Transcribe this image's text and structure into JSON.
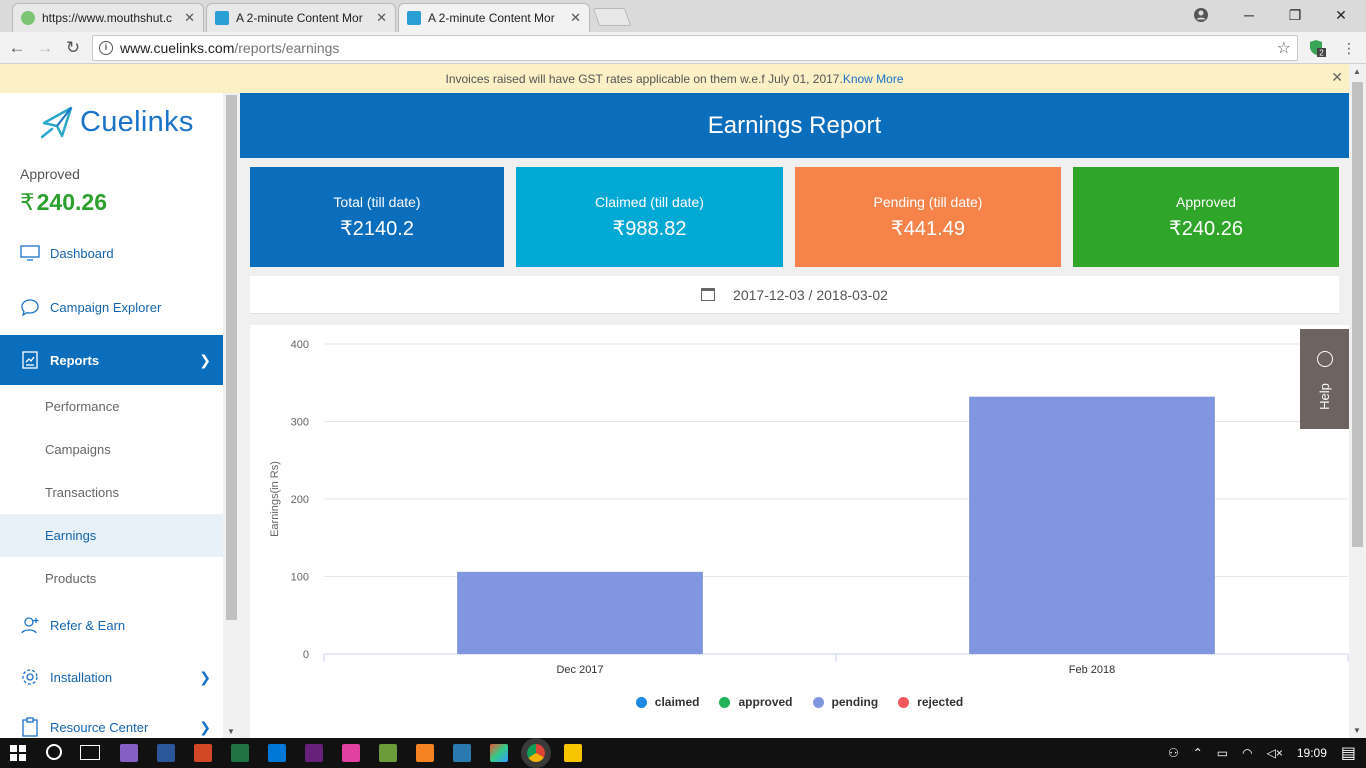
{
  "browser": {
    "tabs": [
      {
        "title": "https://www.mouthshut.c",
        "active": false
      },
      {
        "title": "A 2-minute Content Mor",
        "active": false
      },
      {
        "title": "A 2-minute Content Mor",
        "active": true
      }
    ],
    "url_host": "www.cuelinks.com",
    "url_path": "/reports/earnings",
    "extension_badge": "2"
  },
  "notice": {
    "text": "Invoices raised will have GST rates applicable on them w.e.f July 01, 2017.",
    "link": "Know More"
  },
  "sidebar": {
    "logo_text": "Cuelinks",
    "approved_label": "Approved",
    "currency": "₹",
    "approved_value": "240.26",
    "items": [
      {
        "label": "Dashboard",
        "icon": "monitor-icon"
      },
      {
        "label": "Campaign Explorer",
        "icon": "chat-bubble-icon"
      },
      {
        "label": "Reports",
        "icon": "report-icon",
        "active": true
      },
      {
        "label": "Refer & Earn",
        "icon": "user-plus-icon"
      },
      {
        "label": "Installation",
        "icon": "gear-icon"
      },
      {
        "label": "Resource Center",
        "icon": "clipboard-icon"
      }
    ],
    "sub_items": [
      {
        "label": "Performance"
      },
      {
        "label": "Campaigns"
      },
      {
        "label": "Transactions"
      },
      {
        "label": "Earnings",
        "active": true
      },
      {
        "label": "Products"
      }
    ]
  },
  "main": {
    "title": "Earnings Report",
    "cards": [
      {
        "label": "Total (till date)",
        "value": "₹2140.2",
        "color": "#0a6ebd"
      },
      {
        "label": "Claimed (till date)",
        "value": "₹988.82",
        "color": "#00a8d4"
      },
      {
        "label": "Pending (till date)",
        "value": "₹441.49",
        "color": "#f5834a"
      },
      {
        "label": "Approved",
        "value": "₹240.26",
        "color": "#2fa52a"
      }
    ],
    "date_range": "2017-12-03 / 2018-03-02",
    "help_label": "Help"
  },
  "chart_data": {
    "type": "bar",
    "categories": [
      "Dec 2017",
      "Feb 2018"
    ],
    "series": [
      {
        "name": "claimed",
        "color": "#1e88e5",
        "values": [
          0,
          0
        ]
      },
      {
        "name": "approved",
        "color": "#21b35a",
        "values": [
          0,
          0
        ]
      },
      {
        "name": "pending",
        "color": "#8096e0",
        "values": [
          106,
          332
        ]
      },
      {
        "name": "rejected",
        "color": "#f0575a",
        "values": [
          0,
          0
        ]
      }
    ],
    "ylabel": "Earnings(in Rs)",
    "yticks": [
      0,
      100,
      200,
      300,
      400
    ],
    "ylim": [
      0,
      400
    ],
    "grid": true,
    "legend": "bottom-center"
  },
  "taskbar": {
    "clock": "19:09"
  }
}
